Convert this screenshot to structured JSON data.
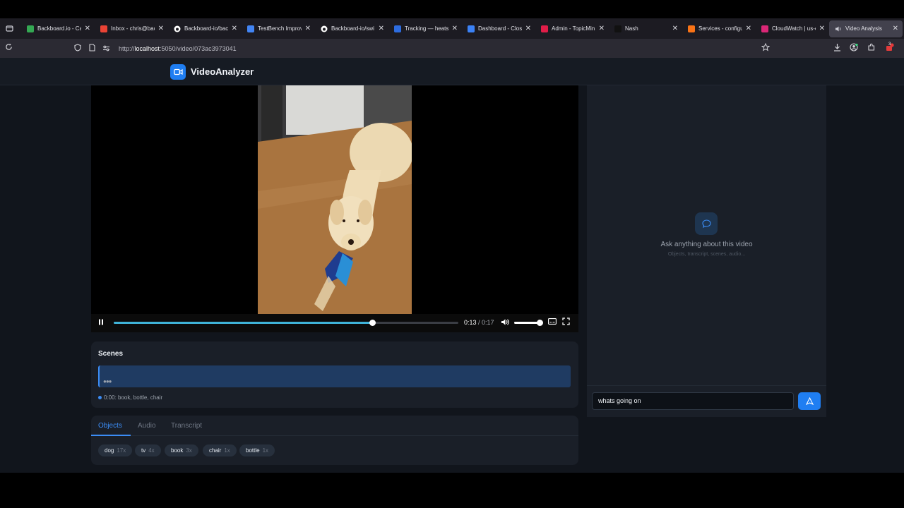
{
  "browser": {
    "tabs": [
      {
        "label": "Backboard.io - Ca",
        "favicon_color": "#34a853",
        "favicon": "31"
      },
      {
        "label": "Inbox - chris@bac",
        "favicon_color": "#ea4335",
        "favicon": "M"
      },
      {
        "label": "Backboard-io/back",
        "favicon_color": "#ffffff",
        "favicon": "github"
      },
      {
        "label": "TestBench Improv",
        "favicon_color": "#4285f4",
        "favicon": "doc"
      },
      {
        "label": "Backboard-io/swi",
        "favicon_color": "#ffffff",
        "favicon": "github"
      },
      {
        "label": "Tracking — heatsi",
        "favicon_color": "#2d6cdf",
        "favicon": "b"
      },
      {
        "label": "Dashboard - Clos",
        "favicon_color": "#3b82f6",
        "favicon": "o"
      },
      {
        "label": "Admin - TopicMin",
        "favicon_color": "#e11d48",
        "favicon": "Q"
      },
      {
        "label": "Nash",
        "favicon_color": "#111111",
        "favicon": "N"
      },
      {
        "label": "Services - configu",
        "favicon_color": "#f97316",
        "favicon": "aws"
      },
      {
        "label": "CloudWatch | us-e",
        "favicon_color": "#db2777",
        "favicon": "cw"
      },
      {
        "label": "Video Analysis",
        "favicon_color": "#cfcfd8",
        "favicon": "speaker",
        "active": true
      }
    ],
    "url_prefix": "http://",
    "url_host": "localhost",
    "url_rest": ":5050/video/073ac3973041",
    "badge_count": "3"
  },
  "app": {
    "brand": "VideoAnalyzer",
    "accent": "#1f7ef2"
  },
  "player": {
    "current_time": "0:13",
    "duration": "/ 0:17",
    "progress": 0.75,
    "volume": 0.85
  },
  "scenes": {
    "title": "Scenes",
    "loading": "●●●",
    "items": [
      {
        "label": "0:00: book, bottle, chair"
      }
    ]
  },
  "panel_tabs": [
    "Objects",
    "Audio",
    "Transcript"
  ],
  "objects": [
    {
      "name": "dog",
      "count": "17x"
    },
    {
      "name": "tv",
      "count": "4x"
    },
    {
      "name": "book",
      "count": "3x"
    },
    {
      "name": "chair",
      "count": "1x"
    },
    {
      "name": "bottle",
      "count": "1x"
    }
  ],
  "chat": {
    "prompt": "Ask anything about this video",
    "hint": "Objects, transcript, scenes, audio...",
    "input_value": "whats going on"
  }
}
